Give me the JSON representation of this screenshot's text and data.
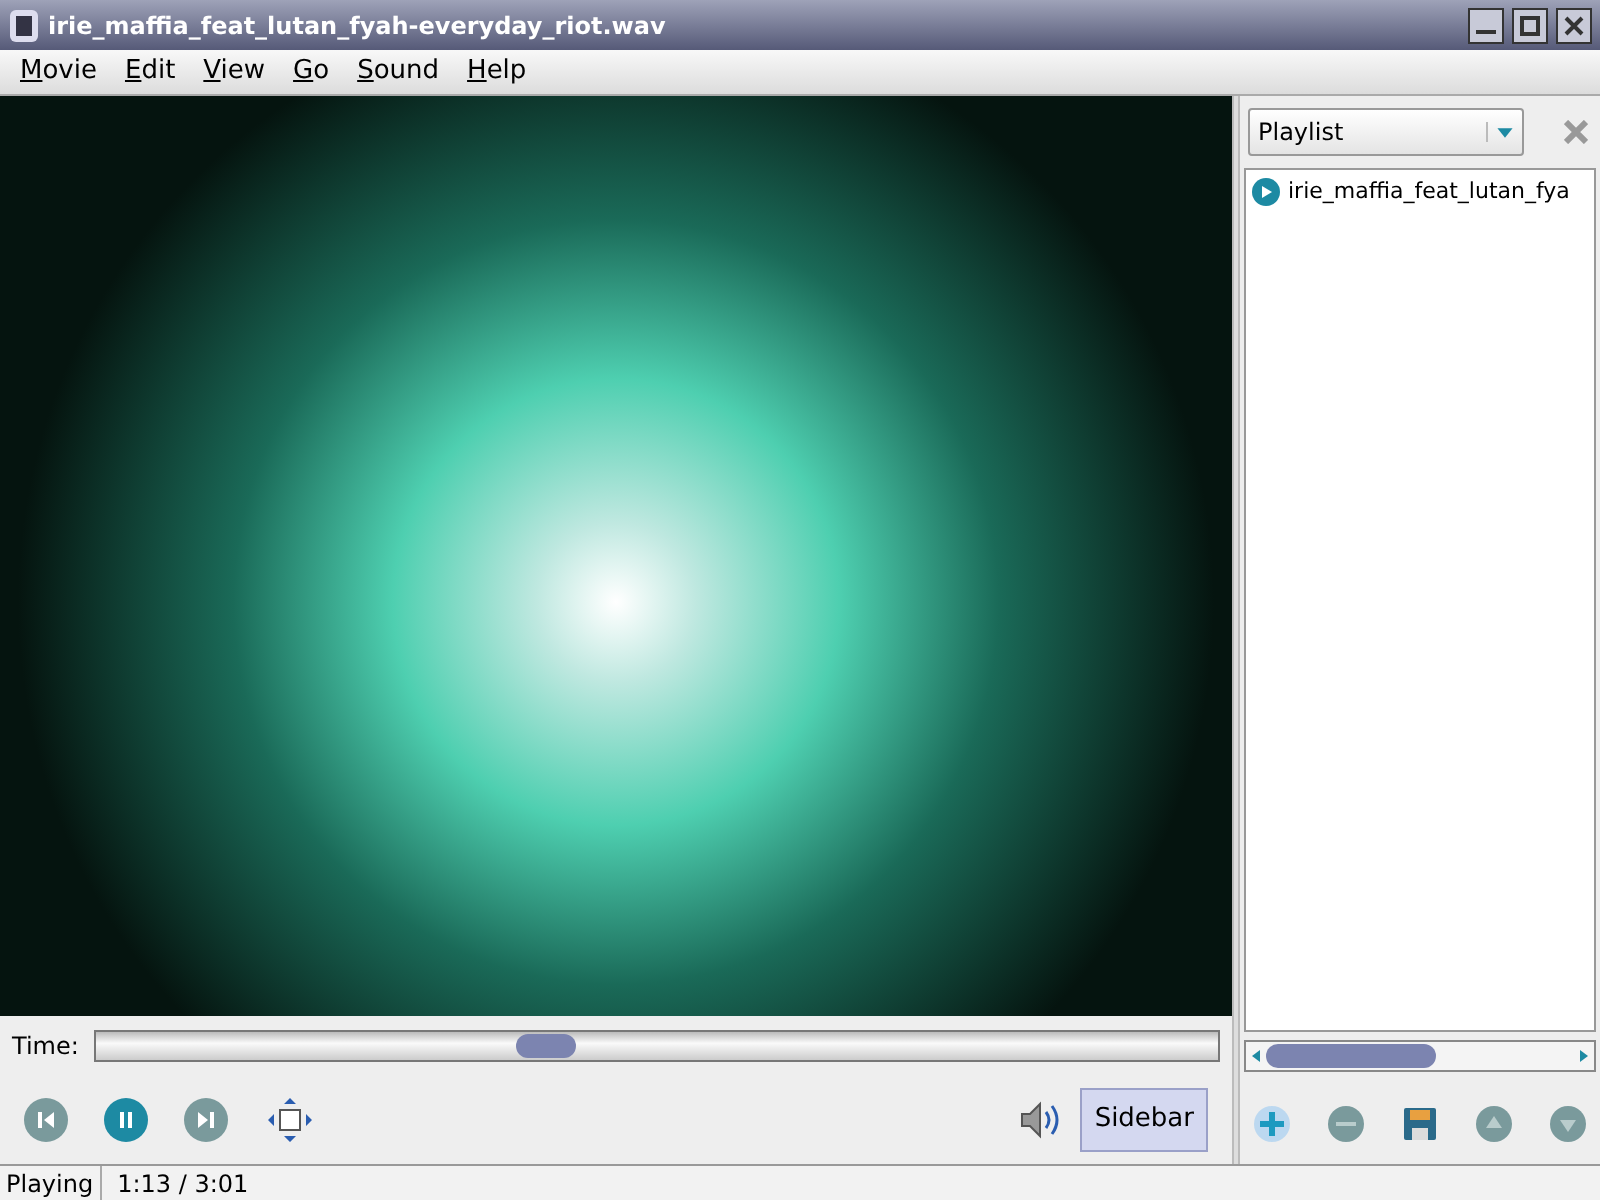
{
  "window": {
    "title": "irie_maffia_feat_lutan_fyah-everyday_riot.wav"
  },
  "menu": [
    {
      "label": "Movie",
      "underlined_first": true
    },
    {
      "label": "Edit",
      "underlined_first": true
    },
    {
      "label": "View",
      "underlined_first": true
    },
    {
      "label": "Go",
      "underlined_first": true
    },
    {
      "label": "Sound",
      "underlined_first": true
    },
    {
      "label": "Help",
      "underlined_first": true
    }
  ],
  "time": {
    "label": "Time:",
    "level": 0.4
  },
  "controls": [
    {
      "kind": "previous",
      "disabled": true
    },
    {
      "kind": "pause",
      "disabled": false
    },
    {
      "kind": "next",
      "disabled": true
    },
    {
      "kind": "fullscreen",
      "disabled": false
    }
  ],
  "sidebar_button": {
    "label": "Sidebar",
    "selected": true
  },
  "sidebar": {
    "selector": "Playlist",
    "items": [
      {
        "label": "irie_maffia_feat_lutan_fya",
        "playing": true
      }
    ],
    "buttons": [
      {
        "kind": "add",
        "disabled": false
      },
      {
        "kind": "remove",
        "disabled": true
      },
      {
        "kind": "save",
        "disabled": false
      },
      {
        "kind": "up",
        "disabled": true
      },
      {
        "kind": "down",
        "disabled": true
      }
    ]
  },
  "status_bar": {
    "state": "Playing",
    "time": "1:13 / 3:01"
  }
}
